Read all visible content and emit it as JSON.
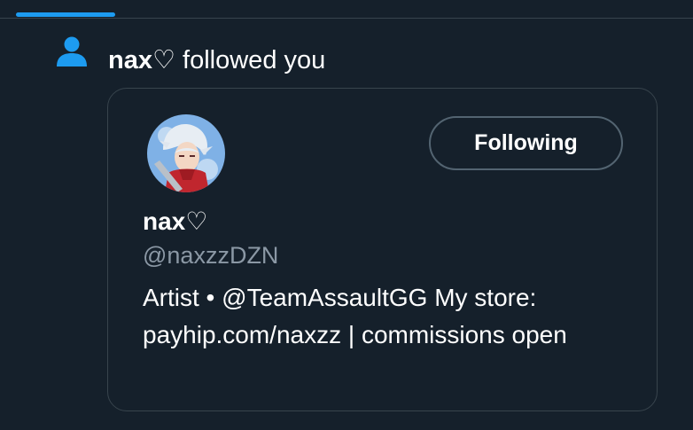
{
  "notification": {
    "actor_name": "nax♡",
    "action_text": " followed you"
  },
  "profile_card": {
    "display_name": "nax♡",
    "handle": "@naxzzDZN",
    "bio": "Artist • @TeamAssaultGG My store: payhip.com/naxzz | commissions open",
    "follow_button_label": "Following"
  },
  "icons": {
    "notification_type": "person-icon",
    "avatar": "avatar-image"
  },
  "colors": {
    "background": "#15202b",
    "accent": "#1d9bf0",
    "border": "#38444d",
    "secondary_text": "#8b98a5"
  }
}
